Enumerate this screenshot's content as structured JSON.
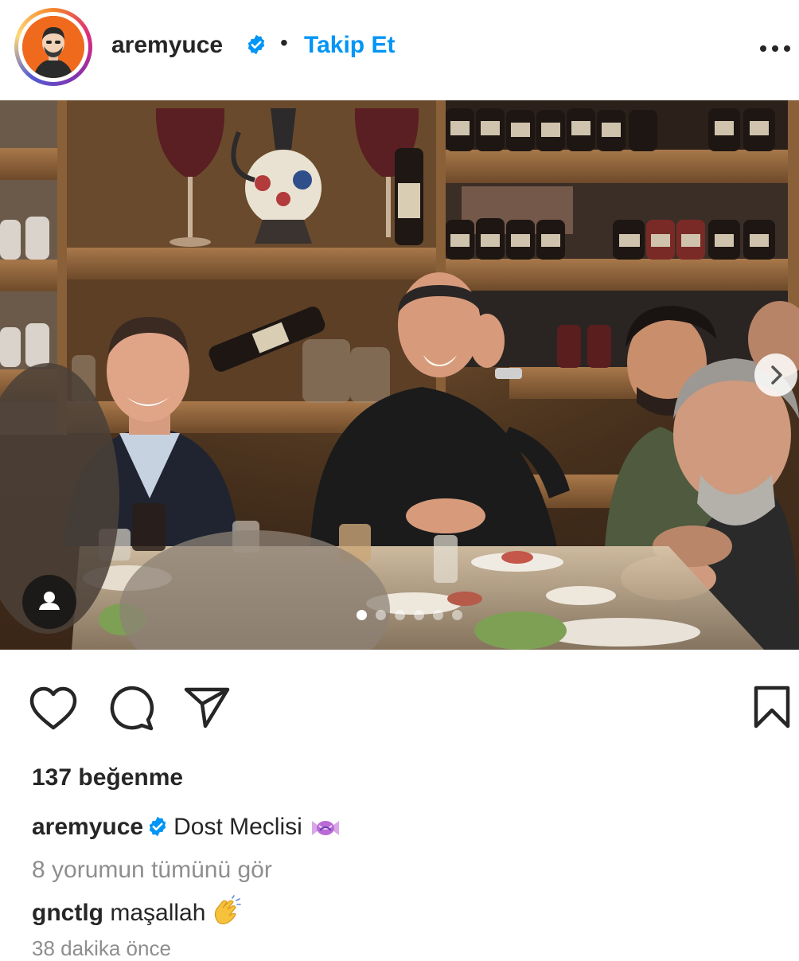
{
  "header": {
    "username": "aremyuce",
    "separator": "•",
    "follow_label": "Takip Et",
    "verified_icon": "verified-badge-icon",
    "more_icon": "more-options-icon"
  },
  "post": {
    "carousel_index": 1,
    "carousel_count": 6,
    "tag_icon": "user-tag-icon",
    "next_icon": "chevron-right-icon"
  },
  "actions": {
    "like_icon": "heart-icon",
    "comment_icon": "comment-icon",
    "share_icon": "send-icon",
    "save_icon": "bookmark-icon"
  },
  "likes_text": "137 beğenme",
  "caption": {
    "username": "aremyuce",
    "text": "Dost Meclisi",
    "emoji_icon": "candy-icon"
  },
  "view_comments": "8 yorumun tümünü gör",
  "comment": {
    "username": "gnctlg",
    "text": "maşallah",
    "emoji_icon": "clapping-hands-icon"
  },
  "timestamp": "38 dakika önce",
  "colors": {
    "accent": "#0095f6",
    "text": "#262626",
    "muted": "#8e8e8e",
    "avatar_bg": "#f06a1e"
  }
}
